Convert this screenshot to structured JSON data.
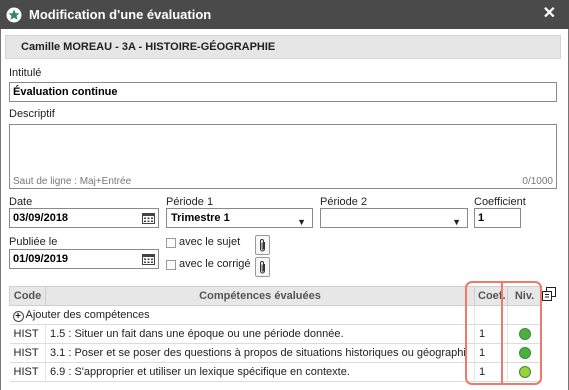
{
  "window": {
    "title": "Modification d'une évaluation",
    "close_glyph": "✕"
  },
  "student": "Camille MOREAU - 3A - HISTOIRE-GÉOGRAPHIE",
  "form": {
    "intitule_label": "Intitulé",
    "intitule_value": "Évaluation continue",
    "descriptif_label": "Descriptif",
    "descriptif_hint": "Saut de ligne : Maj+Entrée",
    "descriptif_counter": "0/1000",
    "date_label": "Date",
    "date_value": "03/09/2018",
    "periode1_label": "Période 1",
    "periode1_value": "Trimestre 1",
    "periode2_label": "Période 2",
    "periode2_value": "",
    "coef_label": "Coefficient",
    "coef_value": "1",
    "publiee_label": "Publiée le",
    "publiee_value": "01/09/2019",
    "avec_sujet": "avec le sujet",
    "avec_corrige": "avec le corrigé"
  },
  "table": {
    "headers": {
      "code": "Code",
      "competences": "Compétences évaluées",
      "coef": "Coef.",
      "niv": "Niv."
    },
    "add_label": "Ajouter des compétences",
    "rows": [
      {
        "code": "HIST",
        "competence": "1.5 : Situer un fait dans une époque ou une période donnée.",
        "coef": "1",
        "niveau_color": "#4caf3e"
      },
      {
        "code": "HIST",
        "competence": "3.1 : Poser et se poser des questions à propos de situations historiques ou géographi",
        "coef": "1",
        "niveau_color": "#4caf3e"
      },
      {
        "code": "HIST",
        "competence": "6.9 : S'approprier et utiliser un lexique spécifique en contexte.",
        "coef": "1",
        "niveau_color": "#9bd23a"
      }
    ]
  },
  "colors": {
    "titlebar": "#4a4a4a",
    "highlight": "#ee7a6c"
  }
}
